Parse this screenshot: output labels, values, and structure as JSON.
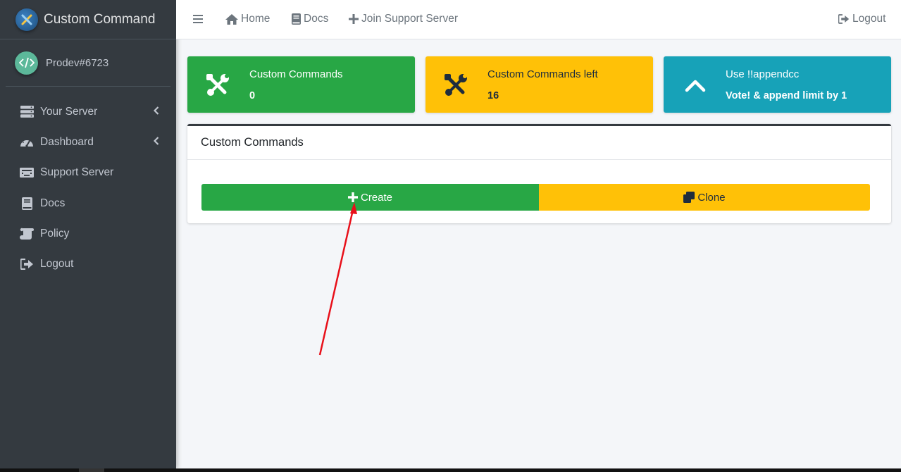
{
  "brand": {
    "title": "Custom Command",
    "logo_icon": "tools-logo-icon"
  },
  "user": {
    "name": "Prodev#6723",
    "avatar_icon": "code-icon"
  },
  "sidebar": {
    "items": [
      {
        "label": "Your Server",
        "icon": "server-icon",
        "has_chevron": true
      },
      {
        "label": "Dashboard",
        "icon": "tachometer-icon",
        "has_chevron": true
      },
      {
        "label": "Support Server",
        "icon": "keyboard-icon",
        "has_chevron": false
      },
      {
        "label": "Docs",
        "icon": "book-icon",
        "has_chevron": false
      },
      {
        "label": "Policy",
        "icon": "scroll-icon",
        "has_chevron": false
      },
      {
        "label": "Logout",
        "icon": "sign-out-icon",
        "has_chevron": false
      }
    ]
  },
  "topbar": {
    "home": "Home",
    "docs": "Docs",
    "join": "Join Support Server",
    "logout": "Logout"
  },
  "info_boxes": [
    {
      "title": "Custom Commands",
      "value": "0",
      "color": "#28a745"
    },
    {
      "title": "Custom Commands left",
      "value": "16",
      "color": "#ffc107"
    },
    {
      "title": "Use !!appendcc",
      "value": "Vote! & append limit by 1",
      "color": "#17a2b8"
    }
  ],
  "card": {
    "title": "Custom Commands",
    "create_label": "Create",
    "clone_label": "Clone"
  },
  "colors": {
    "sidebar_bg": "#343a40",
    "annotation_arrow": "#e8101a"
  }
}
